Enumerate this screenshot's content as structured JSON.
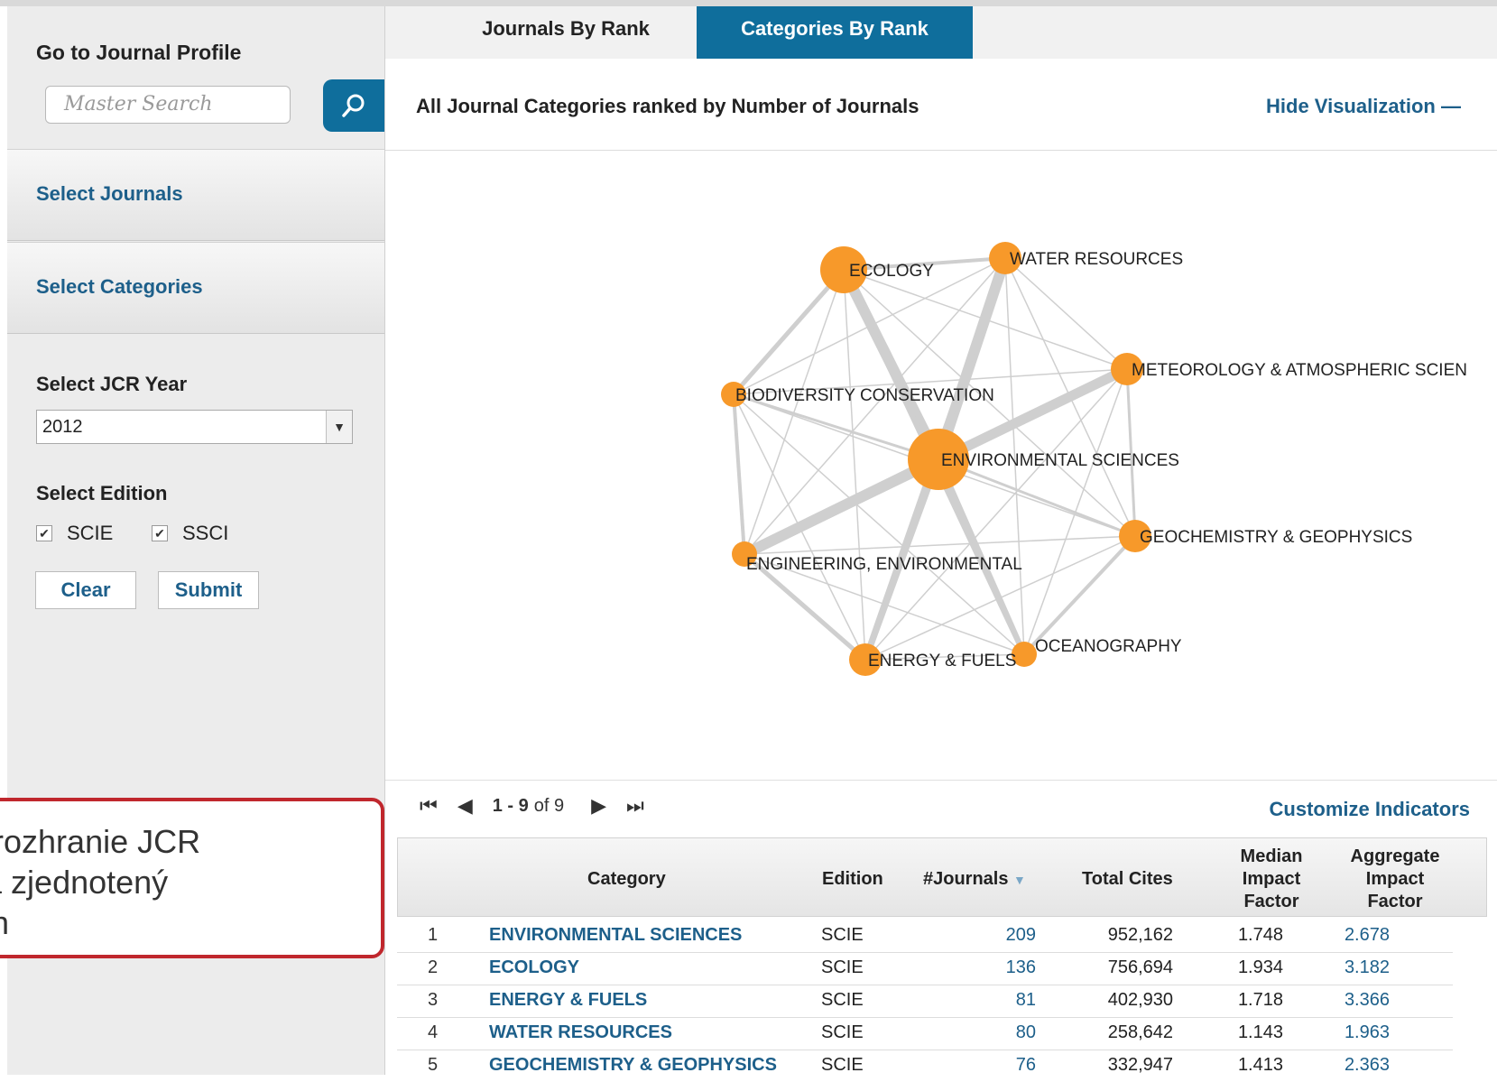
{
  "sidebar": {
    "go_to_profile": "Go to Journal Profile",
    "search_placeholder": "Master Search",
    "select_journals": "Select Journals",
    "select_categories": "Select Categories",
    "select_year_label": "Select JCR Year",
    "year_value": "2012",
    "select_edition_label": "Select Edition",
    "edition_scie": "SCIE",
    "edition_ssci": "SSCI",
    "clear_label": "Clear",
    "submit_label": "Submit"
  },
  "tabs": {
    "journals_by_rank": "Journals By Rank",
    "categories_by_rank": "Categories By Rank"
  },
  "header": {
    "title": "All Journal Categories ranked by Number of Journals",
    "hide_visualization": "Hide Visualization —"
  },
  "network": {
    "nodes": [
      {
        "id": "ecology",
        "label": "ECOLOGY"
      },
      {
        "id": "water",
        "label": "WATER RESOURCES"
      },
      {
        "id": "meteo",
        "label": "METEOROLOGY & ATMOSPHERIC SCIEN"
      },
      {
        "id": "biodiv",
        "label": "BIODIVERSITY CONSERVATION"
      },
      {
        "id": "envsci",
        "label": "ENVIRONMENTAL SCIENCES"
      },
      {
        "id": "geochem",
        "label": "GEOCHEMISTRY & GEOPHYSICS"
      },
      {
        "id": "engenv",
        "label": "ENGINEERING, ENVIRONMENTAL"
      },
      {
        "id": "energy",
        "label": "ENERGY & FUELS"
      },
      {
        "id": "ocean",
        "label": "OCEANOGRAPHY"
      }
    ],
    "node_color": "#f7992a",
    "edge_color": "#cfcfcf"
  },
  "pager": {
    "range": "1 - 9",
    "of_label": "of 9"
  },
  "customize_label": "Customize Indicators",
  "table": {
    "headers": {
      "category": "Category",
      "edition": "Edition",
      "journals": "#Journals",
      "total_cites": "Total Cites",
      "median_if_1": "Median",
      "median_if_2": "Impact",
      "median_if_3": "Factor",
      "aggregate_if_1": "Aggregate",
      "aggregate_if_2": "Impact",
      "aggregate_if_3": "Factor"
    },
    "rows": [
      {
        "rank": "1",
        "category": "ENVIRONMENTAL SCIENCES",
        "edition": "SCIE",
        "journals": "209",
        "total_cites": "952,162",
        "median_if": "1.748",
        "aggregate_if": "2.678"
      },
      {
        "rank": "2",
        "category": "ECOLOGY",
        "edition": "SCIE",
        "journals": "136",
        "total_cites": "756,694",
        "median_if": "1.934",
        "aggregate_if": "3.182"
      },
      {
        "rank": "3",
        "category": "ENERGY & FUELS",
        "edition": "SCIE",
        "journals": "81",
        "total_cites": "402,930",
        "median_if": "1.718",
        "aggregate_if": "3.366"
      },
      {
        "rank": "4",
        "category": "WATER RESOURCES",
        "edition": "SCIE",
        "journals": "80",
        "total_cites": "258,642",
        "median_if": "1.143",
        "aggregate_if": "1.963"
      },
      {
        "rank": "5",
        "category": "GEOCHEMISTRY & GEOPHYSICS",
        "edition": "SCIE",
        "journals": "76",
        "total_cites": "332,947",
        "median_if": "1.413",
        "aggregate_if": "2.363"
      }
    ]
  },
  "callout": {
    "text": "vé rozhranie JCR\náža zjednotený\nsign"
  }
}
